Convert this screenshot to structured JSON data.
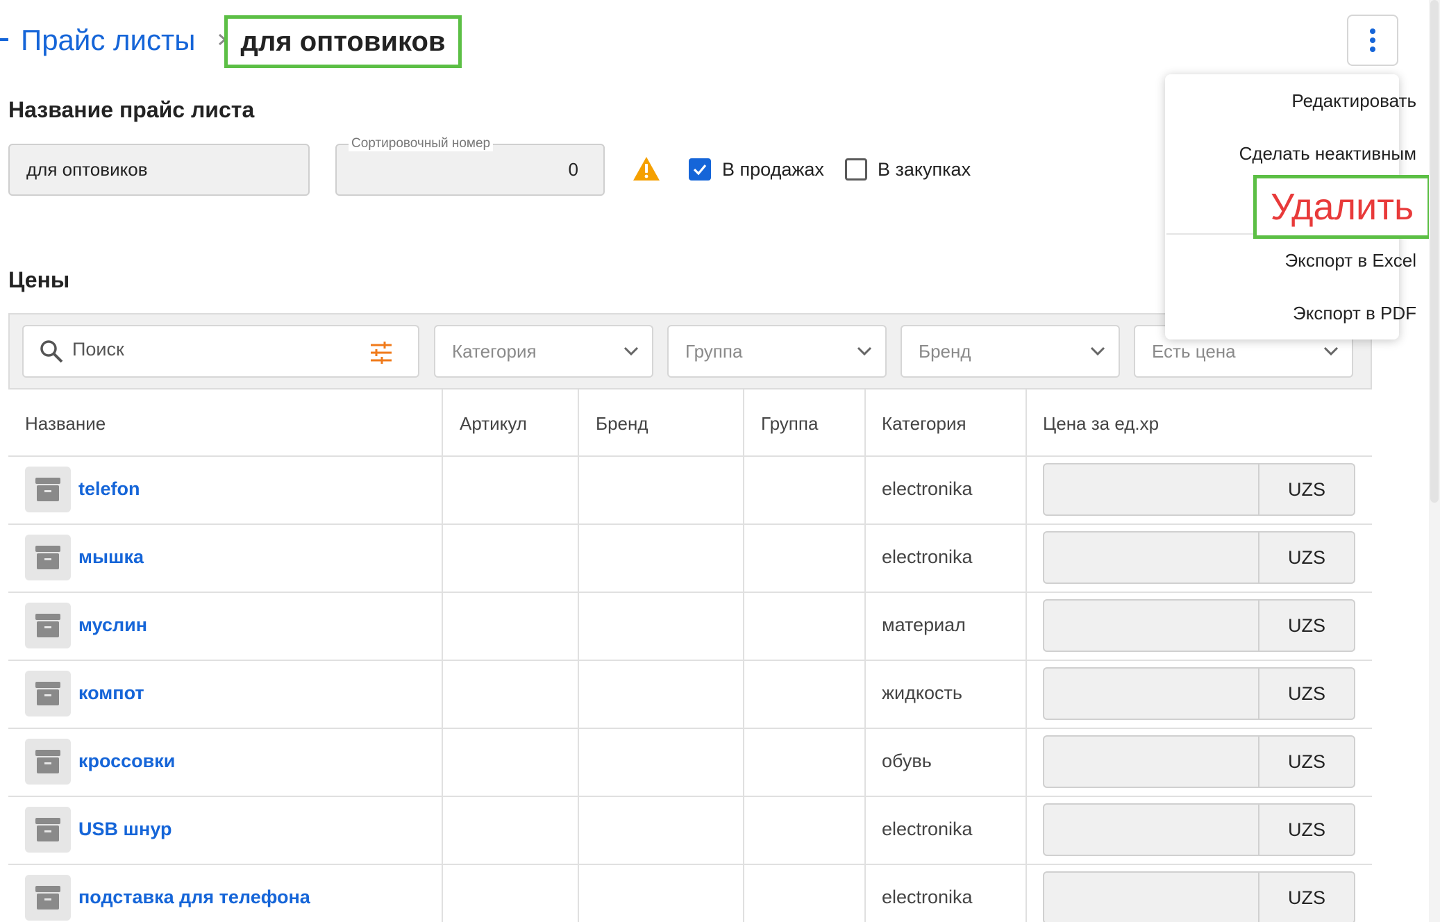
{
  "breadcrumb": {
    "parent": "Прайс листы",
    "current": "для оптовиков"
  },
  "form": {
    "name_title": "Название прайс листа",
    "name_value": "для оптовиков",
    "sort_label": "Сортировочный номер",
    "sort_value": "0",
    "sales_label": "В продажах",
    "sales_checked": true,
    "purchases_label": "В закупках",
    "purchases_checked": false
  },
  "prices": {
    "title": "Цены",
    "search_placeholder": "Поиск",
    "filters": [
      "Категория",
      "Группа",
      "Бренд",
      "Есть цена"
    ]
  },
  "table": {
    "columns": [
      "Название",
      "Артикул",
      "Бренд",
      "Группа",
      "Категория",
      "Цена за ед.хр"
    ],
    "rows": [
      {
        "name": "telefon",
        "category": "electronika",
        "currency": "UZS"
      },
      {
        "name": "мышка",
        "category": "electronika",
        "currency": "UZS"
      },
      {
        "name": "муслин",
        "category": "материал",
        "currency": "UZS"
      },
      {
        "name": "компот",
        "category": "жидкость",
        "currency": "UZS"
      },
      {
        "name": "кроссовки",
        "category": "обувь",
        "currency": "UZS"
      },
      {
        "name": "USB шнур",
        "category": "electronika",
        "currency": "UZS"
      },
      {
        "name": "подставка для телефона",
        "category": "electronika",
        "currency": "UZS"
      }
    ]
  },
  "menu": {
    "edit": "Редактировать",
    "deactivate": "Сделать неактивным",
    "delete": "Удалить",
    "export_excel": "Экспорт в Excel",
    "export_pdf": "Экспорт в PDF"
  },
  "colors": {
    "accent": "#1565d8",
    "highlight": "#5cbf45",
    "danger": "#e83a3a",
    "warning": "#f5a000",
    "filter_icon": "#f07a1a"
  }
}
